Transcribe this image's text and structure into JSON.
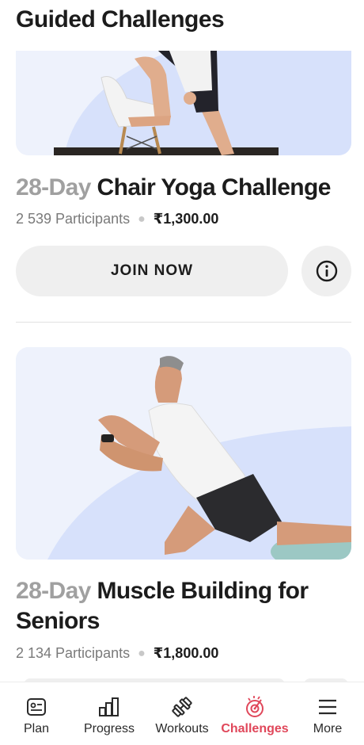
{
  "header": {
    "title": "Guided Challenges"
  },
  "challenges": [
    {
      "duration": "28-Day",
      "name": "Chair Yoga Challenge",
      "participants": "2 539 Participants",
      "price": "₹1,300.00",
      "join_label": "JOIN NOW"
    },
    {
      "duration": "28-Day",
      "name": "Muscle Building for Seniors",
      "participants": "2 134 Participants",
      "price": "₹1,800.00"
    }
  ],
  "tabbar": {
    "active": "Challenges",
    "accent_color": "#e0475a",
    "items": [
      {
        "label": "Plan",
        "icon": "plan-icon"
      },
      {
        "label": "Progress",
        "icon": "progress-chart-icon"
      },
      {
        "label": "Workouts",
        "icon": "dumbbell-icon"
      },
      {
        "label": "Challenges",
        "icon": "challenge-target-icon"
      },
      {
        "label": "More",
        "icon": "hamburger-menu-icon"
      }
    ]
  }
}
